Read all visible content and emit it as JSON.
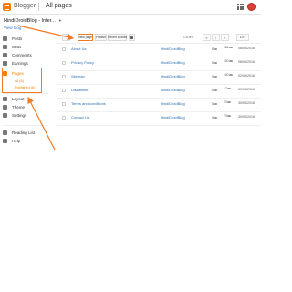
{
  "header": {
    "brand": "Blogger",
    "page_title": "All pages"
  },
  "blog": {
    "selector_label": "HindiDroidBlog - Inter...",
    "view_blog": "View blog"
  },
  "sidebar": {
    "items": [
      {
        "label": "Posts",
        "icon": "posts-icon"
      },
      {
        "label": "Stats",
        "icon": "stats-icon"
      },
      {
        "label": "Comments",
        "icon": "comments-icon"
      },
      {
        "label": "Earnings",
        "icon": "earnings-icon"
      },
      {
        "label": "Pages",
        "icon": "pages-icon"
      },
      {
        "label": "Layout",
        "icon": "layout-icon"
      },
      {
        "label": "Theme",
        "icon": "theme-icon"
      },
      {
        "label": "Settings",
        "icon": "settings-icon"
      },
      {
        "label": "Reading List",
        "icon": "reading-list-icon"
      },
      {
        "label": "Help",
        "icon": "help-icon"
      }
    ],
    "pages_sub": [
      "All (6)",
      "Published (6)"
    ]
  },
  "toolbar": {
    "new_page": "New page",
    "publish": "Publish",
    "revert": "Revert to draft",
    "pager_text": "1-6 of 6",
    "per_page": "10"
  },
  "pages": [
    {
      "title": "About Us",
      "author": "HindiDroidBlog",
      "comments": "0",
      "views": "186",
      "date": "08/05/2016"
    },
    {
      "title": "Privacy Policy",
      "author": "HindiDroidBlog",
      "comments": "0",
      "views": "100",
      "date": "08/05/2016"
    },
    {
      "title": "Sitemap",
      "author": "HindiDroidBlog",
      "comments": "0",
      "views": "100",
      "date": "02/05/2016"
    },
    {
      "title": "Disclaimer",
      "author": "HindiDroidBlog",
      "comments": "0",
      "views": "17",
      "date": "30/04/2016"
    },
    {
      "title": "Terms and conditions",
      "author": "HindiDroidBlog",
      "comments": "0",
      "views": "23",
      "date": "30/04/2016"
    },
    {
      "title": "Contact Us",
      "author": "HindiDroidBlog",
      "comments": "0",
      "views": "73",
      "date": "30/04/2016"
    }
  ],
  "colors": {
    "accent": "#f57d00",
    "highlight": "#ef7b25",
    "link": "#2f6fb5"
  }
}
